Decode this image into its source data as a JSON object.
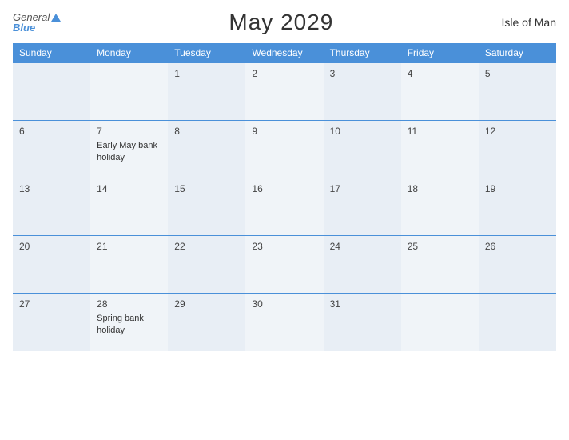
{
  "header": {
    "logo_general": "General",
    "logo_blue": "Blue",
    "title": "May 2029",
    "region": "Isle of Man"
  },
  "calendar": {
    "weekdays": [
      "Sunday",
      "Monday",
      "Tuesday",
      "Wednesday",
      "Thursday",
      "Friday",
      "Saturday"
    ],
    "weeks": [
      [
        {
          "day": "",
          "event": ""
        },
        {
          "day": "",
          "event": ""
        },
        {
          "day": "1",
          "event": ""
        },
        {
          "day": "2",
          "event": ""
        },
        {
          "day": "3",
          "event": ""
        },
        {
          "day": "4",
          "event": ""
        },
        {
          "day": "5",
          "event": ""
        }
      ],
      [
        {
          "day": "6",
          "event": ""
        },
        {
          "day": "7",
          "event": "Early May bank holiday"
        },
        {
          "day": "8",
          "event": ""
        },
        {
          "day": "9",
          "event": ""
        },
        {
          "day": "10",
          "event": ""
        },
        {
          "day": "11",
          "event": ""
        },
        {
          "day": "12",
          "event": ""
        }
      ],
      [
        {
          "day": "13",
          "event": ""
        },
        {
          "day": "14",
          "event": ""
        },
        {
          "day": "15",
          "event": ""
        },
        {
          "day": "16",
          "event": ""
        },
        {
          "day": "17",
          "event": ""
        },
        {
          "day": "18",
          "event": ""
        },
        {
          "day": "19",
          "event": ""
        }
      ],
      [
        {
          "day": "20",
          "event": ""
        },
        {
          "day": "21",
          "event": ""
        },
        {
          "day": "22",
          "event": ""
        },
        {
          "day": "23",
          "event": ""
        },
        {
          "day": "24",
          "event": ""
        },
        {
          "day": "25",
          "event": ""
        },
        {
          "day": "26",
          "event": ""
        }
      ],
      [
        {
          "day": "27",
          "event": ""
        },
        {
          "day": "28",
          "event": "Spring bank holiday"
        },
        {
          "day": "29",
          "event": ""
        },
        {
          "day": "30",
          "event": ""
        },
        {
          "day": "31",
          "event": ""
        },
        {
          "day": "",
          "event": ""
        },
        {
          "day": "",
          "event": ""
        }
      ]
    ],
    "col_classes": [
      "col-sun",
      "col-mon",
      "col-tue",
      "col-wed",
      "col-thu",
      "col-fri",
      "col-sat"
    ]
  }
}
